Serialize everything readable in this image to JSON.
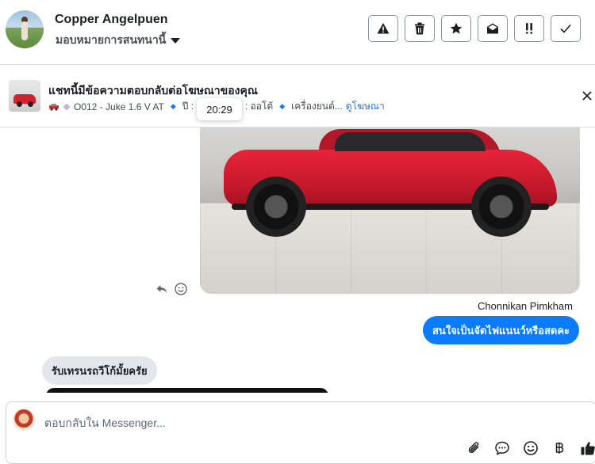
{
  "header": {
    "contact_name": "Copper Angelpuen",
    "assign_label": "มอบหมายการสนทนานี้",
    "actions": [
      "report-icon",
      "trash-icon",
      "star-icon",
      "envelope-open-icon",
      "important-icon",
      "check-icon"
    ]
  },
  "banner": {
    "title": "แชทนี้มีข้อความตอบกลับต่อโฆษณาของคุณ",
    "listing": "O012 - Juke 1.6 V AT",
    "year_partial": "ปี : 2",
    "gear_partial": "ยร์ : ออโต้",
    "engine_partial": "เครื่องยนต์...",
    "view_ad": "ดูโฆษณา",
    "tooltip_time": "20:29"
  },
  "chat": {
    "sender_name": "Chonnikan Pimkham",
    "outgoing_message": "สนใจเป็นจัดไฟแนนว์หรือสดคะ",
    "incoming_message": "รับเทรนรถวีโก้มั้ยครัย"
  },
  "composer": {
    "placeholder": "ตอบกลับใน Messenger..."
  },
  "colors": {
    "accent": "#1877f2",
    "bubble_out": "#0b7bff",
    "bubble_in": "#e4e6eb"
  }
}
